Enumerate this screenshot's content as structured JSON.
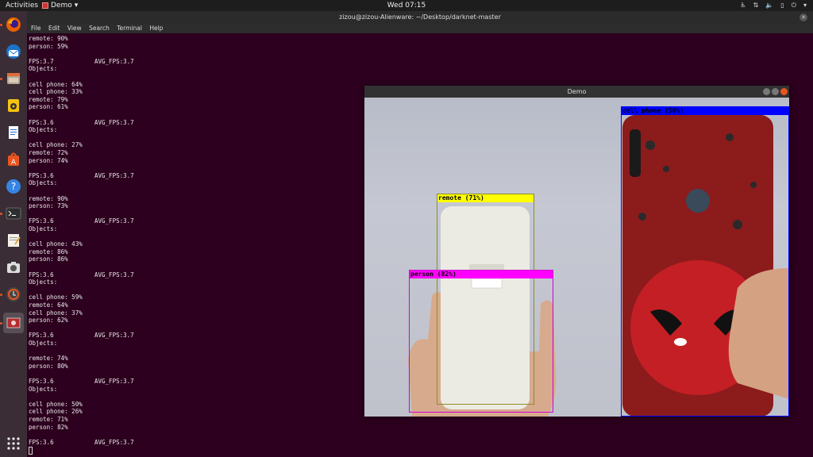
{
  "topbar": {
    "activities": "Activities",
    "app_name": "Demo",
    "clock": "Wed 07:15"
  },
  "dock": {
    "icons": [
      "firefox-icon",
      "thunderbird-icon",
      "files-icon",
      "rhythmbox-icon",
      "writer-icon",
      "software-icon",
      "help-icon",
      "terminal-icon",
      "text-editor-icon",
      "screenshot-icon",
      "updater-icon",
      "demo-app-icon",
      "show-apps-icon"
    ]
  },
  "terminal": {
    "title": "zizou@zizou-Alienware: ~/Desktop/darknet-master",
    "menu": [
      "File",
      "Edit",
      "View",
      "Search",
      "Terminal",
      "Help"
    ],
    "lines": [
      {
        "t": "remote: 90%"
      },
      {
        "t": "person: 59%"
      },
      {
        "t": ""
      },
      {
        "t": "FPS:3.7",
        "a": "AVG_FPS:3.7"
      },
      {
        "t": "Objects:"
      },
      {
        "t": ""
      },
      {
        "t": "cell phone: 64%"
      },
      {
        "t": "cell phone: 33%"
      },
      {
        "t": "remote: 79%"
      },
      {
        "t": "person: 61%"
      },
      {
        "t": ""
      },
      {
        "t": "FPS:3.6",
        "a": "AVG_FPS:3.7"
      },
      {
        "t": "Objects:"
      },
      {
        "t": ""
      },
      {
        "t": "cell phone: 27%"
      },
      {
        "t": "remote: 72%"
      },
      {
        "t": "person: 74%"
      },
      {
        "t": ""
      },
      {
        "t": "FPS:3.6",
        "a": "AVG_FPS:3.7"
      },
      {
        "t": "Objects:"
      },
      {
        "t": ""
      },
      {
        "t": "remote: 90%"
      },
      {
        "t": "person: 73%"
      },
      {
        "t": ""
      },
      {
        "t": "FPS:3.6",
        "a": "AVG_FPS:3.7"
      },
      {
        "t": "Objects:"
      },
      {
        "t": ""
      },
      {
        "t": "cell phone: 43%"
      },
      {
        "t": "remote: 86%"
      },
      {
        "t": "person: 86%"
      },
      {
        "t": ""
      },
      {
        "t": "FPS:3.6",
        "a": "AVG_FPS:3.7"
      },
      {
        "t": "Objects:"
      },
      {
        "t": ""
      },
      {
        "t": "cell phone: 59%"
      },
      {
        "t": "remote: 64%"
      },
      {
        "t": "cell phone: 37%"
      },
      {
        "t": "person: 62%"
      },
      {
        "t": ""
      },
      {
        "t": "FPS:3.6",
        "a": "AVG_FPS:3.7"
      },
      {
        "t": "Objects:"
      },
      {
        "t": ""
      },
      {
        "t": "remote: 74%"
      },
      {
        "t": "person: 80%"
      },
      {
        "t": ""
      },
      {
        "t": "FPS:3.6",
        "a": "AVG_FPS:3.7"
      },
      {
        "t": "Objects:"
      },
      {
        "t": ""
      },
      {
        "t": "cell phone: 50%"
      },
      {
        "t": "cell phone: 26%"
      },
      {
        "t": "remote: 71%"
      },
      {
        "t": "person: 82%"
      },
      {
        "t": ""
      },
      {
        "t": "FPS:3.6",
        "a": "AVG_FPS:3.7"
      }
    ]
  },
  "demo_window": {
    "title": "Demo",
    "detections": [
      {
        "label": "cell phone (50%)",
        "color": "#0000ff"
      },
      {
        "label": "remote (71%)",
        "color": "#ffff00"
      },
      {
        "label": "person (82%)",
        "color": "#ff00ff"
      }
    ]
  }
}
